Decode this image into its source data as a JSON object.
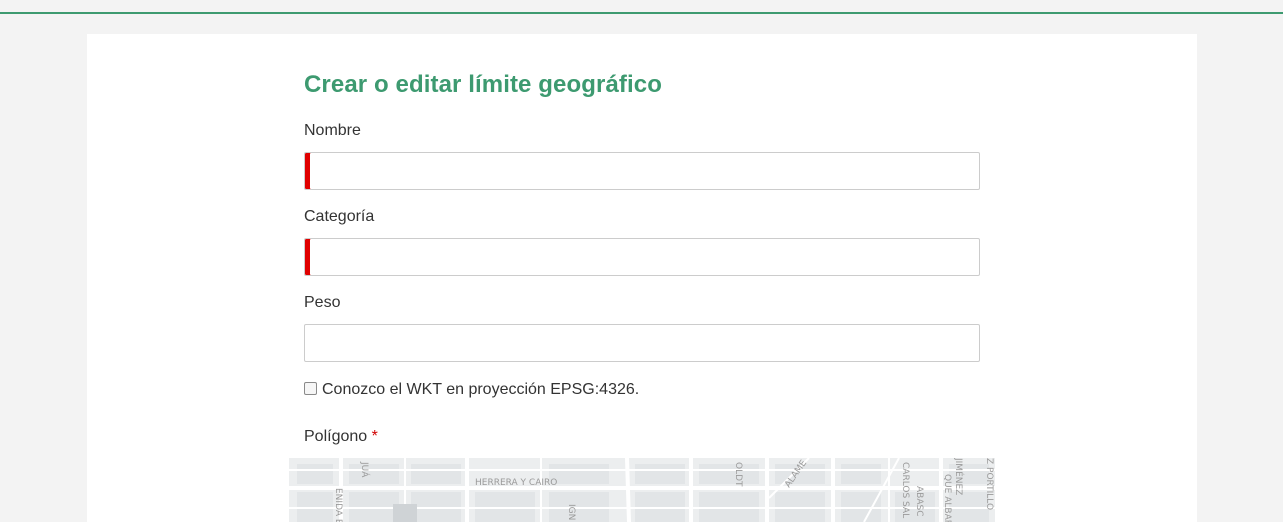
{
  "form": {
    "title": "Crear o editar límite geográfico",
    "fields": [
      {
        "label": "Nombre",
        "value": "",
        "required_indicator": true
      },
      {
        "label": "Categoría",
        "value": "",
        "required_indicator": true
      },
      {
        "label": "Peso",
        "value": "",
        "required_indicator": false
      }
    ],
    "wkt_checkbox": {
      "label": "Conozco el WKT en proyección EPSG:4326.",
      "checked": false
    },
    "polygon": {
      "label": "Polígono",
      "required_mark": "*"
    }
  },
  "map": {
    "street_labels": [
      "HERRERA Y CAIRO",
      "ENIDA ENRIQ",
      "JUÁ",
      "IGN",
      "OLDT",
      "ALAME",
      "CARLOS SAL",
      "JIMÉNEZ",
      "ABASC",
      "QUE ALBARGA",
      "Z PORTILLO"
    ]
  },
  "colors": {
    "accent": "#3d9a70",
    "required": "#e00000",
    "background": "#f3f3f3"
  }
}
